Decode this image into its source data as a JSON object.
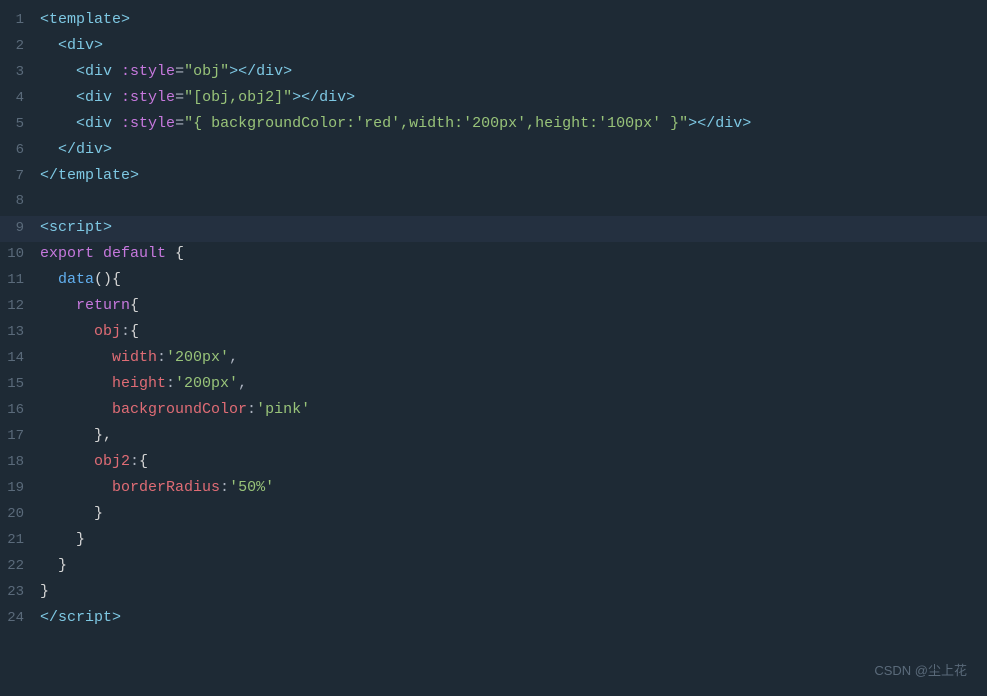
{
  "lines": [
    {
      "number": 1,
      "highlighted": false,
      "tokens": [
        {
          "type": "tag-bracket",
          "text": "<"
        },
        {
          "type": "tag-name",
          "text": "template"
        },
        {
          "type": "tag-bracket",
          "text": ">"
        }
      ]
    },
    {
      "number": 2,
      "highlighted": false,
      "tokens": [
        {
          "type": "plain",
          "text": "  "
        },
        {
          "type": "tag-bracket",
          "text": "<"
        },
        {
          "type": "tag-name",
          "text": "div"
        },
        {
          "type": "tag-bracket",
          "text": ">"
        }
      ]
    },
    {
      "number": 3,
      "highlighted": false,
      "tokens": [
        {
          "type": "plain",
          "text": "    "
        },
        {
          "type": "tag-bracket",
          "text": "<"
        },
        {
          "type": "tag-name",
          "text": "div "
        },
        {
          "type": "attr-name",
          "text": ":style"
        },
        {
          "type": "plain",
          "text": "="
        },
        {
          "type": "attr-value",
          "text": "\"obj\""
        },
        {
          "type": "tag-bracket",
          "text": ">"
        },
        {
          "type": "tag-bracket",
          "text": "</"
        },
        {
          "type": "tag-name",
          "text": "div"
        },
        {
          "type": "tag-bracket",
          "text": ">"
        }
      ]
    },
    {
      "number": 4,
      "highlighted": false,
      "tokens": [
        {
          "type": "plain",
          "text": "    "
        },
        {
          "type": "tag-bracket",
          "text": "<"
        },
        {
          "type": "tag-name",
          "text": "div "
        },
        {
          "type": "attr-name",
          "text": ":style"
        },
        {
          "type": "plain",
          "text": "="
        },
        {
          "type": "attr-value",
          "text": "\"[obj,obj2]\""
        },
        {
          "type": "tag-bracket",
          "text": ">"
        },
        {
          "type": "tag-bracket",
          "text": "</"
        },
        {
          "type": "tag-name",
          "text": "div"
        },
        {
          "type": "tag-bracket",
          "text": ">"
        }
      ]
    },
    {
      "number": 5,
      "highlighted": false,
      "tokens": [
        {
          "type": "plain",
          "text": "    "
        },
        {
          "type": "tag-bracket",
          "text": "<"
        },
        {
          "type": "tag-name",
          "text": "div "
        },
        {
          "type": "attr-name",
          "text": ":style"
        },
        {
          "type": "plain",
          "text": "="
        },
        {
          "type": "attr-value",
          "text": "\"{ backgroundColor:'red',width:'200px',height:'100px' }\""
        },
        {
          "type": "tag-bracket",
          "text": ">"
        },
        {
          "type": "tag-bracket",
          "text": "</"
        },
        {
          "type": "tag-name",
          "text": "div"
        },
        {
          "type": "tag-bracket",
          "text": ">"
        }
      ]
    },
    {
      "number": 6,
      "highlighted": false,
      "tokens": [
        {
          "type": "plain",
          "text": "  "
        },
        {
          "type": "tag-bracket",
          "text": "</"
        },
        {
          "type": "tag-name",
          "text": "div"
        },
        {
          "type": "tag-bracket",
          "text": ">"
        }
      ]
    },
    {
      "number": 7,
      "highlighted": false,
      "tokens": [
        {
          "type": "tag-bracket",
          "text": "</"
        },
        {
          "type": "tag-name",
          "text": "template"
        },
        {
          "type": "tag-bracket",
          "text": ">"
        }
      ]
    },
    {
      "number": 8,
      "highlighted": false,
      "tokens": []
    },
    {
      "number": 9,
      "highlighted": true,
      "tokens": [
        {
          "type": "tag-bracket",
          "text": "<"
        },
        {
          "type": "tag-name",
          "text": "script"
        },
        {
          "type": "tag-bracket",
          "text": ">"
        }
      ]
    },
    {
      "number": 10,
      "highlighted": false,
      "tokens": [
        {
          "type": "keyword-export",
          "text": "export "
        },
        {
          "type": "keyword-default",
          "text": "default "
        },
        {
          "type": "brace",
          "text": "{"
        }
      ]
    },
    {
      "number": 11,
      "highlighted": false,
      "tokens": [
        {
          "type": "plain",
          "text": "  "
        },
        {
          "type": "fn-name",
          "text": "data"
        },
        {
          "type": "brace",
          "text": "(){"
        }
      ]
    },
    {
      "number": 12,
      "highlighted": false,
      "tokens": [
        {
          "type": "plain",
          "text": "    "
        },
        {
          "type": "keyword",
          "text": "return"
        },
        {
          "type": "brace",
          "text": "{"
        }
      ]
    },
    {
      "number": 13,
      "highlighted": false,
      "tokens": [
        {
          "type": "plain",
          "text": "      "
        },
        {
          "type": "prop-name",
          "text": "obj"
        },
        {
          "type": "plain",
          "text": ":"
        },
        {
          "type": "brace",
          "text": "{"
        }
      ]
    },
    {
      "number": 14,
      "highlighted": false,
      "tokens": [
        {
          "type": "plain",
          "text": "        "
        },
        {
          "type": "prop-name",
          "text": "width"
        },
        {
          "type": "plain",
          "text": ":"
        },
        {
          "type": "string-val",
          "text": "'200px'"
        },
        {
          "type": "plain",
          "text": ","
        }
      ]
    },
    {
      "number": 15,
      "highlighted": false,
      "tokens": [
        {
          "type": "plain",
          "text": "        "
        },
        {
          "type": "prop-name",
          "text": "height"
        },
        {
          "type": "plain",
          "text": ":"
        },
        {
          "type": "string-val",
          "text": "'200px'"
        },
        {
          "type": "plain",
          "text": ","
        }
      ]
    },
    {
      "number": 16,
      "highlighted": false,
      "tokens": [
        {
          "type": "plain",
          "text": "        "
        },
        {
          "type": "prop-name",
          "text": "backgroundColor"
        },
        {
          "type": "plain",
          "text": ":"
        },
        {
          "type": "string-val",
          "text": "'pink'"
        }
      ]
    },
    {
      "number": 17,
      "highlighted": false,
      "tokens": [
        {
          "type": "plain",
          "text": "      "
        },
        {
          "type": "brace",
          "text": "},"
        }
      ]
    },
    {
      "number": 18,
      "highlighted": false,
      "tokens": [
        {
          "type": "plain",
          "text": "      "
        },
        {
          "type": "prop-name",
          "text": "obj2"
        },
        {
          "type": "plain",
          "text": ":"
        },
        {
          "type": "brace",
          "text": "{"
        }
      ]
    },
    {
      "number": 19,
      "highlighted": false,
      "tokens": [
        {
          "type": "plain",
          "text": "        "
        },
        {
          "type": "prop-name",
          "text": "borderRadius"
        },
        {
          "type": "plain",
          "text": ":"
        },
        {
          "type": "string-val",
          "text": "'50%'"
        }
      ]
    },
    {
      "number": 20,
      "highlighted": false,
      "tokens": [
        {
          "type": "plain",
          "text": "      "
        },
        {
          "type": "brace",
          "text": "}"
        }
      ]
    },
    {
      "number": 21,
      "highlighted": false,
      "tokens": [
        {
          "type": "plain",
          "text": "    "
        },
        {
          "type": "brace",
          "text": "}"
        }
      ]
    },
    {
      "number": 22,
      "highlighted": false,
      "tokens": [
        {
          "type": "plain",
          "text": "  "
        },
        {
          "type": "brace",
          "text": "}"
        }
      ]
    },
    {
      "number": 23,
      "highlighted": false,
      "tokens": [
        {
          "type": "brace",
          "text": "}"
        }
      ]
    },
    {
      "number": 24,
      "highlighted": false,
      "tokens": [
        {
          "type": "tag-bracket",
          "text": "</"
        },
        {
          "type": "tag-name",
          "text": "script"
        },
        {
          "type": "tag-bracket",
          "text": ">"
        }
      ]
    }
  ],
  "watermark": "CSDN @尘上花"
}
